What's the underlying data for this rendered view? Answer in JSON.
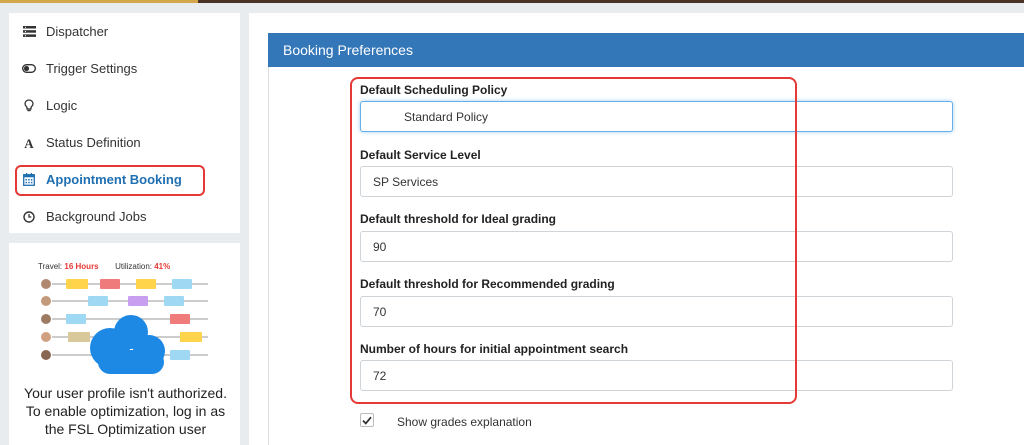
{
  "sidebar": {
    "items": [
      {
        "label": "Dispatcher",
        "icon": "list-icon"
      },
      {
        "label": "Trigger Settings",
        "icon": "toggle-icon"
      },
      {
        "label": "Logic",
        "icon": "lightbulb-icon"
      },
      {
        "label": "Status Definition",
        "icon": "font-icon"
      },
      {
        "label": "Appointment Booking",
        "icon": "calendar-icon",
        "active": true
      },
      {
        "label": "Background Jobs",
        "icon": "clock-icon"
      }
    ]
  },
  "promo": {
    "travel_label": "Travel:",
    "travel_value": "16 Hours",
    "utilization_label": "Utilization:",
    "utilization_value": "41%",
    "message": "Your user profile isn't authorized. To enable optimization, log in as the FSL Optimization user"
  },
  "panel": {
    "title": "Booking Preferences",
    "fields": [
      {
        "label": "Default Scheduling Policy",
        "value": "Standard Policy"
      },
      {
        "label": "Default Service Level",
        "value": "SP Services"
      },
      {
        "label": "Default threshold for Ideal grading",
        "value": "90"
      },
      {
        "label": "Default threshold for Recommended grading",
        "value": "70"
      },
      {
        "label": "Number of hours for initial appointment search",
        "value": "72"
      }
    ],
    "checkbox": {
      "label": "Show grades explanation",
      "checked": true
    }
  },
  "colors": {
    "accent": "#3477b9",
    "active_link": "#1f6fb2",
    "highlight_red": "#e53935",
    "cloud_blue": "#1e88e5"
  }
}
